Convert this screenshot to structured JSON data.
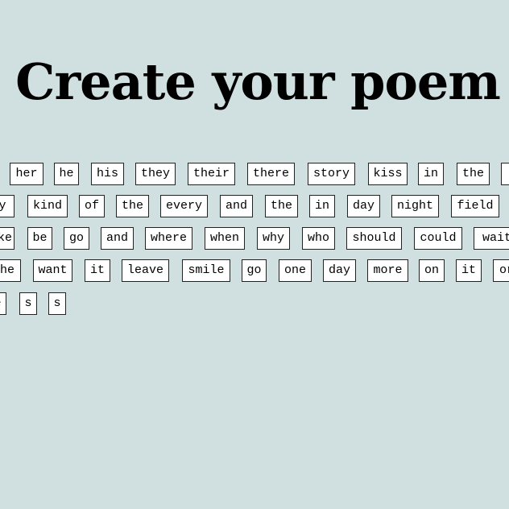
{
  "page": {
    "title": "Create your poem",
    "background": "#d0dfe0"
  },
  "words": {
    "row1": [
      "her",
      "he",
      "his",
      "they",
      "their",
      "there",
      "story",
      "kiss",
      "in",
      "the",
      "n"
    ],
    "row2": [
      "y",
      "kind",
      "of",
      "the",
      "every",
      "and",
      "the",
      "in",
      "day",
      "night",
      "field"
    ],
    "row3": [
      "ke",
      "be",
      "go",
      "and",
      "where",
      "when",
      "why",
      "who",
      "should",
      "could",
      "wait"
    ],
    "row4": [
      "he",
      "want",
      "it",
      "leave",
      "smile",
      "go",
      "one",
      "day",
      "more",
      "on",
      "it",
      "or"
    ],
    "row5": [
      "e",
      "s",
      "s"
    ]
  }
}
